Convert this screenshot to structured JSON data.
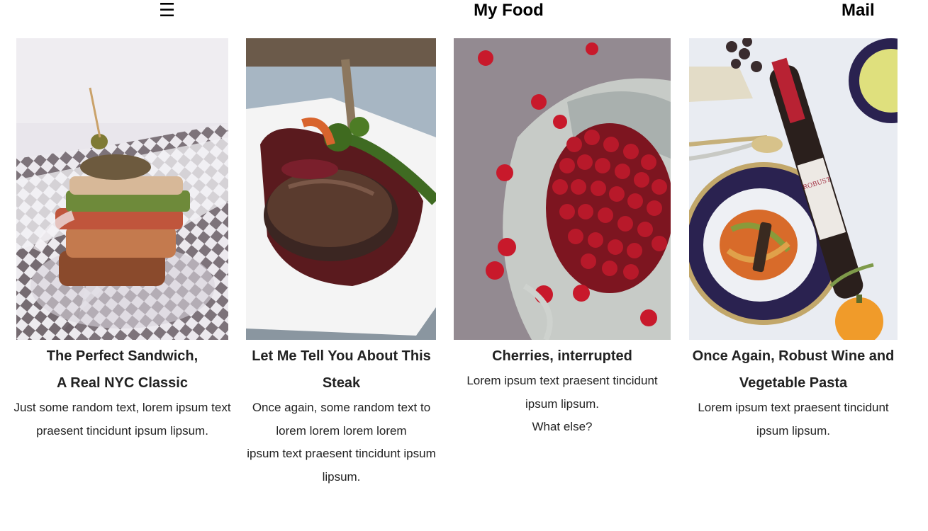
{
  "header": {
    "menu_glyph": "☰",
    "title": "My Food",
    "mail_label": "Mail"
  },
  "cards": [
    {
      "title_lines": [
        "The Perfect Sandwich,",
        "A Real NYC Classic"
      ],
      "text_lines": [
        "Just some random text, lorem ipsum text",
        "praesent tincidunt ipsum lipsum."
      ],
      "image": "sandwich-photo"
    },
    {
      "title_lines": [
        "Let Me Tell You About This",
        "Steak"
      ],
      "text_lines": [
        "Once again, some random text to",
        "lorem lorem lorem lorem",
        "ipsum text praesent tincidunt ipsum",
        "lipsum."
      ],
      "image": "steak-photo"
    },
    {
      "title_lines": [
        "Cherries, interrupted"
      ],
      "text_lines": [
        "Lorem ipsum text praesent tincidunt",
        "ipsum lipsum.",
        "What else?"
      ],
      "image": "cherries-photo"
    },
    {
      "title_lines": [
        "Once Again, Robust Wine and",
        "Vegetable Pasta"
      ],
      "text_lines": [
        "Lorem ipsum text praesent tincidunt",
        "ipsum lipsum."
      ],
      "image": "wine-pasta-photo",
      "wine_label": "ROBUST"
    }
  ]
}
